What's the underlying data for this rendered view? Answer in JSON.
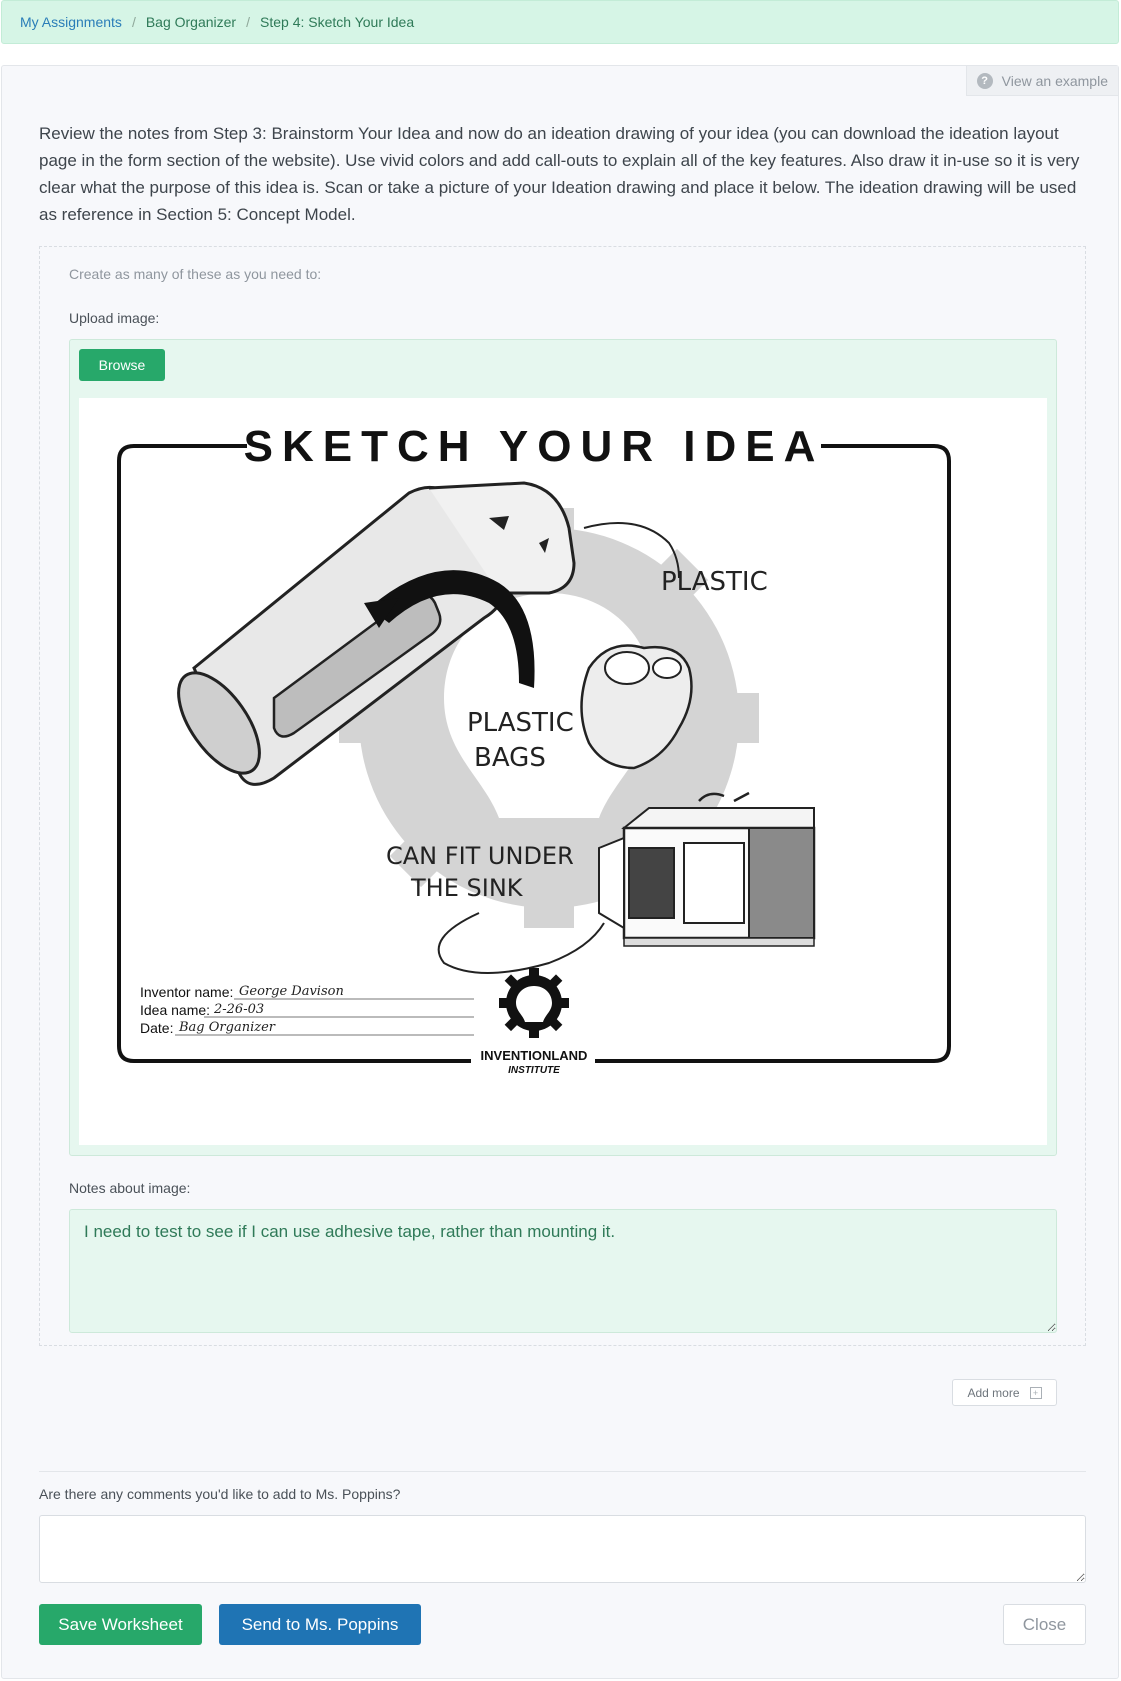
{
  "breadcrumb": {
    "items": [
      "My Assignments",
      "Bag Organizer",
      "Step 4: Sketch Your Idea"
    ],
    "separator": "/"
  },
  "header": {
    "view_example": "View an example",
    "view_example_icon": "question-circle-icon"
  },
  "instructions": "Review the notes from Step 3: Brainstorm Your Idea and now do an ideation drawing of your idea (you can download the ideation layout page in the form section of the website). Use vivid colors and add call-outs to explain all of the key features. Also draw it in-use so it is very clear what the purpose of this idea is. Scan or take a picture of your Ideation drawing and place it below. The ideation drawing will be used as reference in Section 5: Concept Model.",
  "form": {
    "hint": "Create as many of these as you need to:",
    "upload_label": "Upload image:",
    "browse_label": "Browse",
    "notes_label": "Notes about image:",
    "notes_value": "I need to test to see if I can use adhesive tape, rather than mounting it.",
    "add_more_label": "Add more"
  },
  "sketch": {
    "title": "SKETCH YOUR IDEA",
    "callout_plastic": "PLASTIC",
    "callout_bags_1": "PLASTIC",
    "callout_bags_2": "BAGS",
    "callout_sink_1": "CAN FIT UNDER",
    "callout_sink_2": "THE SINK",
    "field_inventor_label": "Inventor name:",
    "field_inventor_value": "George Davison",
    "field_idea_label": "Idea name:",
    "field_idea_value": "2-26-03",
    "field_date_label": "Date:",
    "field_date_value": "Bag Organizer",
    "logo_line1": "INVENTIONLAND",
    "logo_line2": "INSTITUTE"
  },
  "comments": {
    "label": "Are there any comments you'd like to add to Ms. Poppins?",
    "value": ""
  },
  "actions": {
    "save_label": "Save Worksheet",
    "send_label": "Send to Ms. Poppins",
    "close_label": "Close"
  },
  "colors": {
    "accent_green": "#27a86a",
    "accent_blue": "#1f74b4",
    "light_green": "#e6f7ef",
    "breadcrumb_bg": "#d6f5e6"
  }
}
